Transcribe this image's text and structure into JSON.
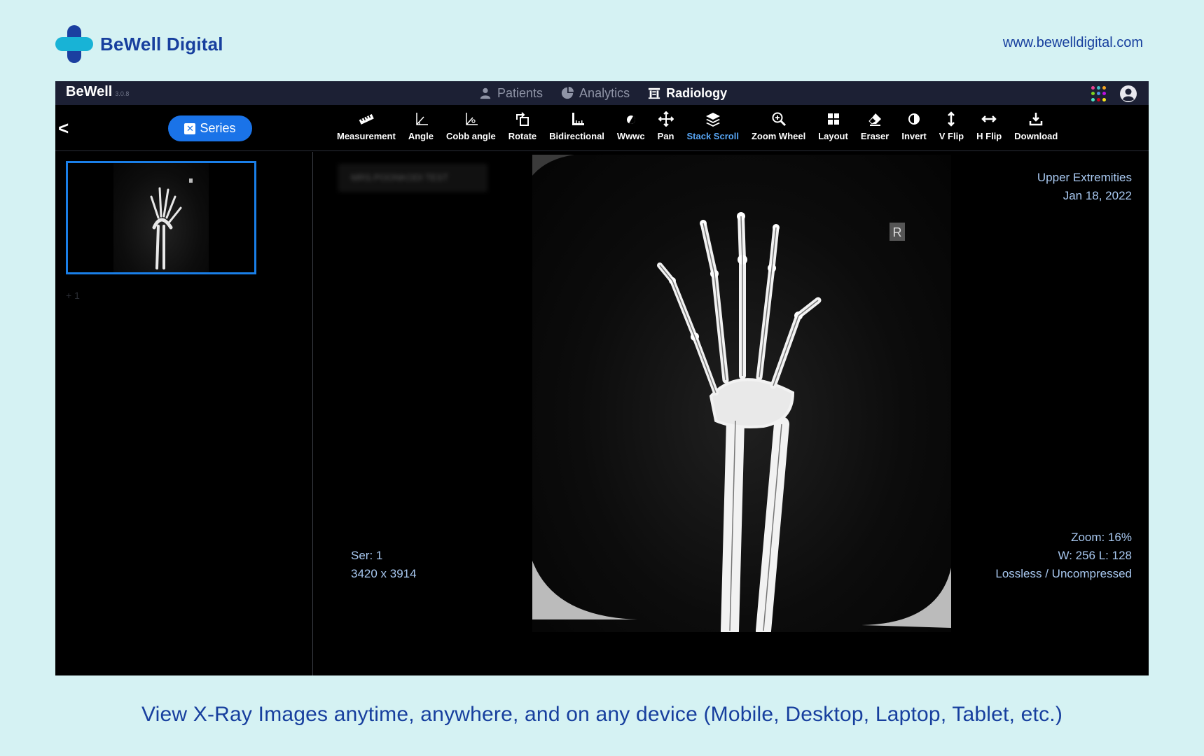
{
  "brand": {
    "name": "BeWell Digital",
    "url": "www.bewelldigital.com"
  },
  "app": {
    "title": "BeWell",
    "version": "3.0.8",
    "nav": [
      {
        "label": "Patients",
        "icon": "user-icon"
      },
      {
        "label": "Analytics",
        "icon": "pie-chart-icon"
      },
      {
        "label": "Radiology",
        "icon": "radiology-icon",
        "active": true
      }
    ],
    "series_button": "Series",
    "back_label": "<",
    "tools": [
      {
        "label": "Measurement",
        "icon": "ruler-icon"
      },
      {
        "label": "Angle",
        "icon": "angle-icon"
      },
      {
        "label": "Cobb angle",
        "icon": "cobb-angle-icon"
      },
      {
        "label": "Rotate",
        "icon": "rotate-icon"
      },
      {
        "label": "Bidirectional",
        "icon": "bidirectional-icon"
      },
      {
        "label": "Wwwc",
        "icon": "contrast-drop-icon"
      },
      {
        "label": "Pan",
        "icon": "pan-icon"
      },
      {
        "label": "Stack Scroll",
        "icon": "layers-icon",
        "active": true
      },
      {
        "label": "Zoom Wheel",
        "icon": "zoom-icon"
      },
      {
        "label": "Layout",
        "icon": "layout-grid-icon"
      },
      {
        "label": "Eraser",
        "icon": "eraser-icon"
      },
      {
        "label": "Invert",
        "icon": "invert-icon"
      },
      {
        "label": "V Flip",
        "icon": "vertical-flip-icon"
      },
      {
        "label": "H Flip",
        "icon": "horizontal-flip-icon"
      },
      {
        "label": "Download",
        "icon": "download-icon"
      }
    ],
    "thumbnail_count": "+ 1",
    "patient_name_blurred": "MRS.POONKODI TEST",
    "viewport": {
      "study": "Upper Extremities",
      "date": "Jan 18, 2022",
      "orientation_marker": "R",
      "series": "Ser: 1",
      "dimensions": "3420 x 3914",
      "zoom": "Zoom: 16%",
      "window_level": "W: 256 L: 128",
      "compression": "Lossless / Uncompressed"
    }
  },
  "tagline": "View X-Ray Images anytime, anywhere, and on any device (Mobile, Desktop, Laptop, Tablet, etc.)",
  "colors": {
    "background": "#d5f2f3",
    "brand_blue": "#173f9e",
    "brand_cyan": "#18b3d6",
    "accent": "#1a73e8",
    "overlay_text": "#a8c8f0"
  }
}
